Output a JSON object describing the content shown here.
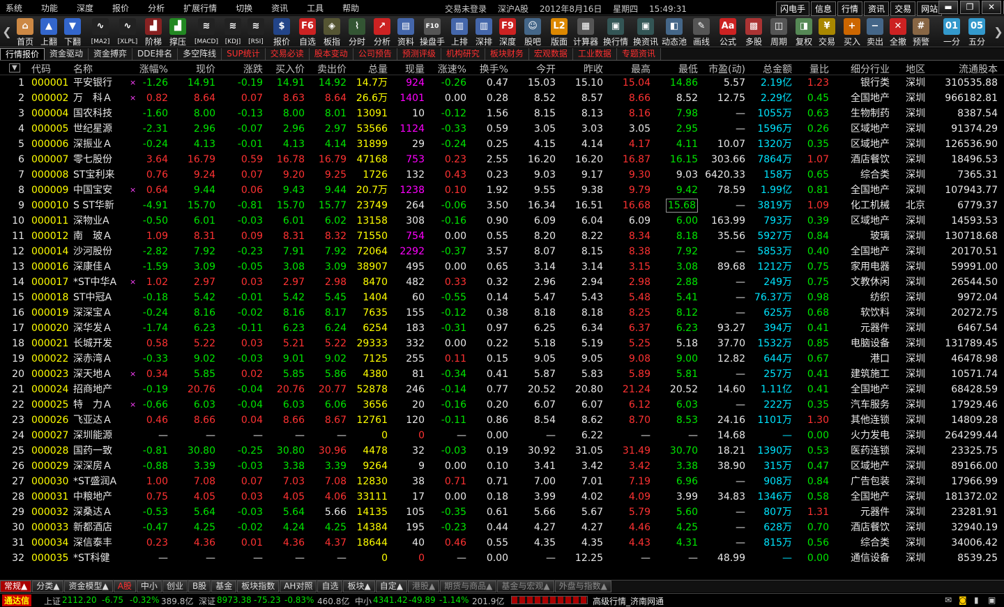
{
  "menu": [
    "系统",
    "功能",
    "深度",
    "报价",
    "分析",
    "扩展行情",
    "切换",
    "资讯",
    "工具",
    "帮助"
  ],
  "title": {
    "login": "交易未登录",
    "market": "深沪A股",
    "date": "2012年8月16日",
    "weekday": "星期四",
    "time": "15:49:31"
  },
  "quick_links": [
    "闪电手",
    "信息",
    "行情",
    "资讯",
    "交易",
    "网站"
  ],
  "win_controls": [
    "▬",
    "❐",
    "✕",
    "✕"
  ],
  "toolbar": [
    {
      "label": "首页",
      "icon": "home-icon",
      "sym": "⌂",
      "color": "#c84"
    },
    {
      "label": "上翻",
      "icon": "up-arrow-icon",
      "sym": "▲",
      "color": "#36c"
    },
    {
      "label": "下翻",
      "icon": "down-arrow-icon",
      "sym": "▼",
      "color": "#36c"
    },
    {
      "label": "[MA2]",
      "icon": "ma2-chart-icon",
      "sym": "∿",
      "color": "#222"
    },
    {
      "label": "[XLPL]",
      "icon": "xlpl-chart-icon",
      "sym": "∿",
      "color": "#222"
    },
    {
      "label": "阶梯",
      "icon": "ladder-chart-icon",
      "sym": "▟",
      "color": "#822"
    },
    {
      "label": "撑压",
      "icon": "support-chart-icon",
      "sym": "▟",
      "color": "#282"
    },
    {
      "label": "[MACD]",
      "icon": "macd-chart-icon",
      "sym": "≋",
      "color": "#222"
    },
    {
      "label": "[KDJ]",
      "icon": "kdj-chart-icon",
      "sym": "≋",
      "color": "#222"
    },
    {
      "label": "[RSI]",
      "icon": "rsi-chart-icon",
      "sym": "≋",
      "color": "#222"
    },
    {
      "label": "报价",
      "icon": "quote-icon",
      "sym": "$",
      "color": "#248"
    },
    {
      "label": "自选",
      "icon": "f6-key-icon",
      "sym": "F6",
      "color": "#c22"
    },
    {
      "label": "板指",
      "icon": "sector-index-icon",
      "sym": "◈",
      "color": "#553"
    },
    {
      "label": "分时",
      "icon": "timeshare-icon",
      "sym": "⌇",
      "color": "#353"
    },
    {
      "label": "分析",
      "icon": "analysis-icon",
      "sym": "↗",
      "color": "#c22"
    },
    {
      "label": "资料",
      "icon": "document-icon",
      "sym": "▤",
      "color": "#46a"
    },
    {
      "label": "操盘手",
      "icon": "f10-key-icon",
      "sym": "F10",
      "color": "#555"
    },
    {
      "label": "上排",
      "icon": "sh-rank-icon",
      "sym": "▥",
      "color": "#46a"
    },
    {
      "label": "深排",
      "icon": "sz-rank-icon",
      "sym": "▥",
      "color": "#46a"
    },
    {
      "label": "深度",
      "icon": "f9-key-icon",
      "sym": "F9",
      "color": "#c22"
    },
    {
      "label": "股吧",
      "icon": "forum-icon",
      "sym": "☺",
      "color": "#468"
    },
    {
      "label": "版面",
      "icon": "l2-layout-icon",
      "sym": "L2",
      "color": "#d80"
    },
    {
      "label": "计算器",
      "icon": "calculator-icon",
      "sym": "▦",
      "color": "#555"
    },
    {
      "label": "换行情",
      "icon": "switch-quote-icon",
      "sym": "▣",
      "color": "#355"
    },
    {
      "label": "换资讯",
      "icon": "switch-news-icon",
      "sym": "▣",
      "color": "#355"
    },
    {
      "label": "动态池",
      "icon": "dynamic-pool-icon",
      "sym": "◧",
      "color": "#468"
    },
    {
      "label": "画线",
      "icon": "draw-line-icon",
      "sym": "✎",
      "color": "#555"
    },
    {
      "label": "公式",
      "icon": "formula-icon",
      "sym": "Aa",
      "color": "#c22"
    },
    {
      "label": "多股",
      "icon": "multi-stock-icon",
      "sym": "▩",
      "color": "#a33"
    },
    {
      "label": "周期",
      "icon": "period-icon",
      "sym": "◫",
      "color": "#555"
    },
    {
      "label": "复权",
      "icon": "adjust-icon",
      "sym": "◨",
      "color": "#585"
    },
    {
      "label": "交易",
      "icon": "trade-icon",
      "sym": "¥",
      "color": "#a80"
    },
    {
      "label": "买入",
      "icon": "buy-icon",
      "sym": "+",
      "color": "#c60"
    },
    {
      "label": "卖出",
      "icon": "sell-icon",
      "sym": "−",
      "color": "#468"
    },
    {
      "label": "全撤",
      "icon": "cancel-all-icon",
      "sym": "✕",
      "color": "#c22"
    },
    {
      "label": "预警",
      "icon": "alert-icon",
      "sym": "#",
      "color": "#864"
    },
    {
      "label": "一分",
      "icon": "one-minute-icon",
      "sym": "01",
      "color": "#39c"
    },
    {
      "label": "五分",
      "icon": "five-minute-icon",
      "sym": "05",
      "color": "#39c"
    }
  ],
  "tabs_top": [
    {
      "label": "行情报价",
      "active": true,
      "red": false
    },
    {
      "label": "资金驱动",
      "active": false,
      "red": false
    },
    {
      "label": "资金搏弈",
      "active": false,
      "red": false
    },
    {
      "label": "DDE排名",
      "active": false,
      "red": false
    },
    {
      "label": "多空阵线",
      "active": false,
      "red": false
    },
    {
      "label": "SUP统计",
      "active": false,
      "red": true
    },
    {
      "label": "交易必读",
      "active": false,
      "red": true
    },
    {
      "label": "股本变动",
      "active": false,
      "red": true
    },
    {
      "label": "公司预告",
      "active": false,
      "red": true
    },
    {
      "label": "预测评级",
      "active": false,
      "red": true
    },
    {
      "label": "机构研究",
      "active": false,
      "red": true
    },
    {
      "label": "板块财务",
      "active": false,
      "red": true
    },
    {
      "label": "宏观数据",
      "active": false,
      "red": true
    },
    {
      "label": "工业数据",
      "active": false,
      "red": true
    },
    {
      "label": "专题资讯",
      "active": false,
      "red": true
    }
  ],
  "columns": [
    "代码",
    "名称",
    "涨幅%",
    "现价",
    "涨跌",
    "买入价",
    "卖出价",
    "总量",
    "现量",
    "涨速%",
    "换手%",
    "今开",
    "昨收",
    "最高",
    "最低",
    "市盈(动)",
    "总金额",
    "量比",
    "细分行业",
    "地区",
    "流通股本"
  ],
  "rows": [
    [
      "1",
      "000001",
      "平安银行",
      "×",
      "-1.26",
      "14.91",
      "-0.19",
      "14.91",
      "14.92",
      "14.7万",
      "924",
      "-0.26",
      "0.47",
      "15.03",
      "15.10",
      "15.04",
      "14.86",
      "5.57",
      "2.19亿",
      "1.23",
      "银行类",
      "深圳",
      "310535.88"
    ],
    [
      "2",
      "000002",
      "万　科Ａ",
      "×",
      "0.82",
      "8.64",
      "0.07",
      "8.63",
      "8.64",
      "26.6万",
      "1401",
      "0.00",
      "0.28",
      "8.52",
      "8.57",
      "8.66",
      "8.52",
      "12.75",
      "2.29亿",
      "0.45",
      "全国地产",
      "深圳",
      "966182.81"
    ],
    [
      "3",
      "000004",
      "国农科技",
      "",
      "-1.60",
      "8.00",
      "-0.13",
      "8.00",
      "8.01",
      "13091",
      "10",
      "-0.12",
      "1.56",
      "8.15",
      "8.13",
      "8.16",
      "7.98",
      "—",
      "1055万",
      "0.63",
      "生物制药",
      "深圳",
      "8387.54"
    ],
    [
      "4",
      "000005",
      "世纪星源",
      "",
      "-2.31",
      "2.96",
      "-0.07",
      "2.96",
      "2.97",
      "53566",
      "1124",
      "-0.33",
      "0.59",
      "3.05",
      "3.03",
      "3.05",
      "2.95",
      "—",
      "1596万",
      "0.26",
      "区域地产",
      "深圳",
      "91374.29"
    ],
    [
      "5",
      "000006",
      "深振业Ａ",
      "",
      "-0.24",
      "4.13",
      "-0.01",
      "4.13",
      "4.14",
      "31899",
      "29",
      "-0.24",
      "0.25",
      "4.15",
      "4.14",
      "4.17",
      "4.11",
      "10.07",
      "1320万",
      "0.35",
      "区域地产",
      "深圳",
      "126536.90"
    ],
    [
      "6",
      "000007",
      "零七股份",
      "",
      "3.64",
      "16.79",
      "0.59",
      "16.78",
      "16.79",
      "47168",
      "753",
      "0.23",
      "2.55",
      "16.20",
      "16.20",
      "16.87",
      "16.15",
      "303.66",
      "7864万",
      "1.07",
      "酒店餐饮",
      "深圳",
      "18496.53"
    ],
    [
      "7",
      "000008",
      "ST宝利来",
      "",
      "0.76",
      "9.24",
      "0.07",
      "9.20",
      "9.25",
      "1726",
      "132",
      "0.43",
      "0.23",
      "9.03",
      "9.17",
      "9.30",
      "9.03",
      "6420.33",
      "158万",
      "0.65",
      "综合类",
      "深圳",
      "7365.31"
    ],
    [
      "8",
      "000009",
      "中国宝安",
      "×",
      "0.64",
      "9.44",
      "0.06",
      "9.43",
      "9.44",
      "20.7万",
      "1238",
      "0.10",
      "1.92",
      "9.55",
      "9.38",
      "9.79",
      "9.42",
      "78.59",
      "1.99亿",
      "0.81",
      "全国地产",
      "深圳",
      "107943.77"
    ],
    [
      "9",
      "000010",
      "S ST华新",
      "",
      "-4.91",
      "15.70",
      "-0.81",
      "15.70",
      "15.77",
      "23749",
      "264",
      "-0.06",
      "3.50",
      "16.34",
      "16.51",
      "16.68",
      "15.68",
      "—",
      "3819万",
      "1.09",
      "化工机械",
      "北京",
      "6779.37"
    ],
    [
      "10",
      "000011",
      "深物业A",
      "",
      "-0.50",
      "6.01",
      "-0.03",
      "6.01",
      "6.02",
      "13158",
      "308",
      "-0.16",
      "0.90",
      "6.09",
      "6.04",
      "6.09",
      "6.00",
      "163.99",
      "793万",
      "0.39",
      "区域地产",
      "深圳",
      "14593.53"
    ],
    [
      "11",
      "000012",
      "南　玻Ａ",
      "",
      "1.09",
      "8.31",
      "0.09",
      "8.31",
      "8.32",
      "71550",
      "754",
      "0.00",
      "0.55",
      "8.20",
      "8.22",
      "8.34",
      "8.18",
      "35.56",
      "5927万",
      "0.84",
      "玻璃",
      "深圳",
      "130718.68"
    ],
    [
      "12",
      "000014",
      "沙河股份",
      "",
      "-2.82",
      "7.92",
      "-0.23",
      "7.91",
      "7.92",
      "72064",
      "2292",
      "-0.37",
      "3.57",
      "8.07",
      "8.15",
      "8.38",
      "7.92",
      "—",
      "5853万",
      "0.40",
      "全国地产",
      "深圳",
      "20170.51"
    ],
    [
      "13",
      "000016",
      "深康佳Ａ",
      "",
      "-1.59",
      "3.09",
      "-0.05",
      "3.08",
      "3.09",
      "38907",
      "495",
      "0.00",
      "0.65",
      "3.14",
      "3.14",
      "3.15",
      "3.08",
      "89.68",
      "1212万",
      "0.75",
      "家用电器",
      "深圳",
      "59991.00"
    ],
    [
      "14",
      "000017",
      "*ST中华A",
      "×",
      "1.02",
      "2.97",
      "0.03",
      "2.97",
      "2.98",
      "8470",
      "482",
      "0.33",
      "0.32",
      "2.96",
      "2.94",
      "2.98",
      "2.88",
      "—",
      "249万",
      "0.75",
      "文教休闲",
      "深圳",
      "26544.50"
    ],
    [
      "15",
      "000018",
      "ST中冠A",
      "",
      "-0.18",
      "5.42",
      "-0.01",
      "5.42",
      "5.45",
      "1404",
      "60",
      "-0.55",
      "0.14",
      "5.47",
      "5.43",
      "5.48",
      "5.41",
      "—",
      "76.37万",
      "0.98",
      "纺织",
      "深圳",
      "9972.04"
    ],
    [
      "16",
      "000019",
      "深深宝Ａ",
      "",
      "-0.24",
      "8.16",
      "-0.02",
      "8.16",
      "8.17",
      "7635",
      "155",
      "-0.12",
      "0.38",
      "8.18",
      "8.18",
      "8.25",
      "8.12",
      "—",
      "625万",
      "0.68",
      "软饮料",
      "深圳",
      "20272.75"
    ],
    [
      "17",
      "000020",
      "深华发Ａ",
      "",
      "-1.74",
      "6.23",
      "-0.11",
      "6.23",
      "6.24",
      "6254",
      "183",
      "-0.31",
      "0.97",
      "6.25",
      "6.34",
      "6.37",
      "6.23",
      "93.27",
      "394万",
      "0.41",
      "元器件",
      "深圳",
      "6467.54"
    ],
    [
      "18",
      "000021",
      "长城开发",
      "",
      "0.58",
      "5.22",
      "0.03",
      "5.21",
      "5.22",
      "29333",
      "332",
      "0.00",
      "0.22",
      "5.18",
      "5.19",
      "5.25",
      "5.18",
      "37.70",
      "1532万",
      "0.85",
      "电脑设备",
      "深圳",
      "131789.45"
    ],
    [
      "19",
      "000022",
      "深赤湾Ａ",
      "",
      "-0.33",
      "9.02",
      "-0.03",
      "9.01",
      "9.02",
      "7125",
      "255",
      "0.11",
      "0.15",
      "9.05",
      "9.05",
      "9.08",
      "9.00",
      "12.82",
      "644万",
      "0.67",
      "港口",
      "深圳",
      "46478.98"
    ],
    [
      "20",
      "000023",
      "深天地Ａ",
      "×",
      "0.34",
      "5.85",
      "0.02",
      "5.85",
      "5.86",
      "4380",
      "81",
      "-0.34",
      "0.41",
      "5.87",
      "5.83",
      "5.89",
      "5.81",
      "—",
      "257万",
      "0.41",
      "建筑施工",
      "深圳",
      "10571.74"
    ],
    [
      "21",
      "000024",
      "招商地产",
      "",
      "-0.19",
      "20.76",
      "-0.04",
      "20.76",
      "20.77",
      "52878",
      "246",
      "-0.14",
      "0.77",
      "20.52",
      "20.80",
      "21.24",
      "20.52",
      "14.60",
      "1.11亿",
      "0.41",
      "全国地产",
      "深圳",
      "68428.59"
    ],
    [
      "22",
      "000025",
      "特　力Ａ",
      "×",
      "-0.66",
      "6.03",
      "-0.04",
      "6.03",
      "6.06",
      "3656",
      "20",
      "-0.16",
      "0.20",
      "6.07",
      "6.07",
      "6.12",
      "6.03",
      "—",
      "222万",
      "0.35",
      "汽车服务",
      "深圳",
      "17929.46"
    ],
    [
      "23",
      "000026",
      "飞亚达Ａ",
      "",
      "0.46",
      "8.66",
      "0.04",
      "8.66",
      "8.67",
      "12761",
      "120",
      "-0.11",
      "0.86",
      "8.54",
      "8.62",
      "8.70",
      "8.53",
      "24.16",
      "1101万",
      "1.30",
      "其他连锁",
      "深圳",
      "14809.28"
    ],
    [
      "24",
      "000027",
      "深圳能源",
      "",
      "—",
      "—",
      "—",
      "—",
      "—",
      "0",
      "0",
      "—",
      "0.00",
      "—",
      "6.22",
      "—",
      "—",
      "14.68",
      "—",
      "0.00",
      "火力发电",
      "深圳",
      "264299.44"
    ],
    [
      "25",
      "000028",
      "国药一致",
      "",
      "-0.81",
      "30.80",
      "-0.25",
      "30.80",
      "30.96",
      "4478",
      "32",
      "-0.03",
      "0.19",
      "30.92",
      "31.05",
      "31.49",
      "30.70",
      "18.21",
      "1390万",
      "0.53",
      "医药连锁",
      "深圳",
      "23325.75"
    ],
    [
      "26",
      "000029",
      "深深房Ａ",
      "",
      "-0.88",
      "3.39",
      "-0.03",
      "3.38",
      "3.39",
      "9264",
      "9",
      "0.00",
      "0.10",
      "3.41",
      "3.42",
      "3.42",
      "3.38",
      "38.90",
      "315万",
      "0.47",
      "区域地产",
      "深圳",
      "89166.00"
    ],
    [
      "27",
      "000030",
      "*ST盛润A",
      "",
      "1.00",
      "7.08",
      "0.07",
      "7.03",
      "7.08",
      "12830",
      "38",
      "0.71",
      "0.71",
      "7.00",
      "7.01",
      "7.19",
      "6.96",
      "—",
      "908万",
      "0.84",
      "广告包装",
      "深圳",
      "17966.99"
    ],
    [
      "28",
      "000031",
      "中粮地产",
      "",
      "0.75",
      "4.05",
      "0.03",
      "4.05",
      "4.06",
      "33111",
      "17",
      "0.00",
      "0.18",
      "3.99",
      "4.02",
      "4.09",
      "3.99",
      "34.83",
      "1346万",
      "0.58",
      "全国地产",
      "深圳",
      "181372.02"
    ],
    [
      "29",
      "000032",
      "深桑达Ａ",
      "",
      "-0.53",
      "5.64",
      "-0.03",
      "5.64",
      "5.66",
      "14135",
      "105",
      "-0.35",
      "0.61",
      "5.66",
      "5.67",
      "5.79",
      "5.60",
      "—",
      "807万",
      "1.31",
      "元器件",
      "深圳",
      "23281.91"
    ],
    [
      "30",
      "000033",
      "新都酒店",
      "",
      "-0.47",
      "4.25",
      "-0.02",
      "4.24",
      "4.25",
      "14384",
      "195",
      "-0.23",
      "0.44",
      "4.27",
      "4.27",
      "4.46",
      "4.25",
      "—",
      "628万",
      "0.70",
      "酒店餐饮",
      "深圳",
      "32940.19"
    ],
    [
      "31",
      "000034",
      "深信泰丰",
      "",
      "0.23",
      "4.36",
      "0.01",
      "4.36",
      "4.37",
      "18644",
      "40",
      "0.46",
      "0.55",
      "4.35",
      "4.35",
      "4.43",
      "4.31",
      "—",
      "815万",
      "0.56",
      "综合类",
      "深圳",
      "34006.42"
    ],
    [
      "32",
      "000035",
      "*ST科健",
      "",
      "—",
      "—",
      "—",
      "—",
      "—",
      "0",
      "0",
      "—",
      "0.00",
      "—",
      "12.25",
      "—",
      "—",
      "48.99",
      "—",
      "0.00",
      "通信设备",
      "深圳",
      "8539.25"
    ]
  ],
  "bottom_tabs": [
    {
      "label": "常规▲",
      "active": true,
      "dim": false
    },
    {
      "label": "分类▲",
      "active": false,
      "dim": false
    },
    {
      "label": "资金模型▲",
      "active": false,
      "dim": false
    },
    {
      "label": "A股",
      "active": false,
      "dim": false
    },
    {
      "label": "中小",
      "active": false,
      "dim": false
    },
    {
      "label": "创业",
      "active": false,
      "dim": false
    },
    {
      "label": "B股",
      "active": false,
      "dim": false
    },
    {
      "label": "基金",
      "active": false,
      "dim": false
    },
    {
      "label": "板块指数",
      "active": false,
      "dim": false
    },
    {
      "label": "AH对照",
      "active": false,
      "dim": false
    },
    {
      "label": "自选",
      "active": false,
      "dim": false
    },
    {
      "label": "板块▲",
      "active": false,
      "dim": false
    },
    {
      "label": "自定▲",
      "active": false,
      "dim": false
    },
    {
      "label": "港股▲",
      "active": false,
      "dim": true
    },
    {
      "label": "期货与商品▲",
      "active": false,
      "dim": true
    },
    {
      "label": "基金与宏观▲",
      "active": false,
      "dim": true
    },
    {
      "label": "外盘与指数▲",
      "active": false,
      "dim": true
    }
  ],
  "status": {
    "brand": "通达信",
    "sh_label": "上证",
    "sh_index": "2112.20",
    "sh_chg": "-6.75",
    "sh_pct": "-0.32%",
    "sh_amt": "389.8亿",
    "sz_label": "深证",
    "sz_index": "8973.38",
    "sz_chg": "-75.23",
    "sz_pct": "-0.83%",
    "sz_amt": "460.8亿",
    "zx_label": "中小",
    "zx_index": "4341.42",
    "zx_chg": "-49.89",
    "zx_pct": "-1.14%",
    "zx_amt": "201.9亿",
    "server": "高级行情_济南网通"
  },
  "colors": {
    "up": "#ff3232",
    "down": "#00e600",
    "flat": "#e8e8e8",
    "volume": "#ffff00",
    "amount": "#00e5ff",
    "nowvol": "#ff00ff"
  }
}
